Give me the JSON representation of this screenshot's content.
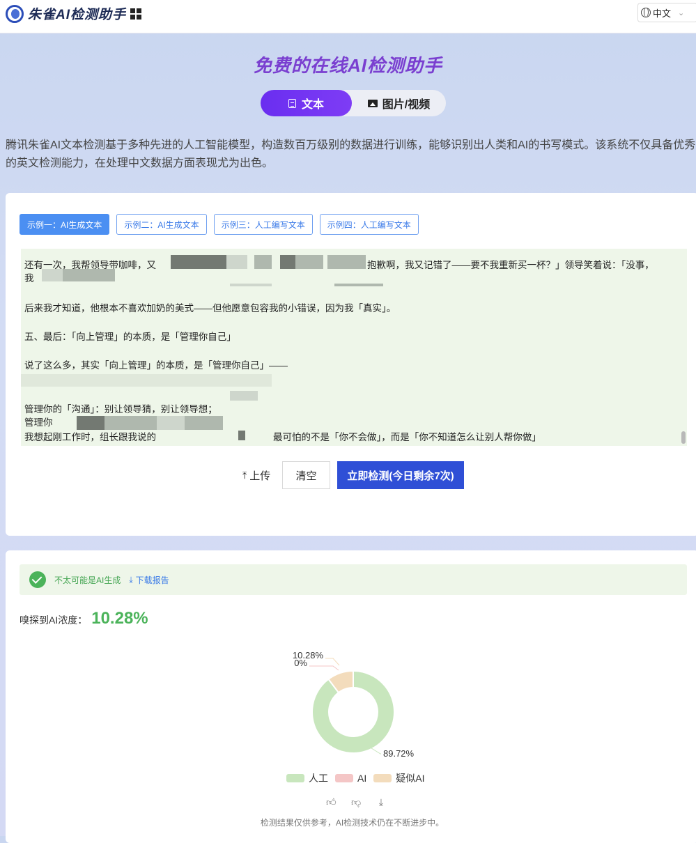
{
  "header": {
    "brand": "朱雀AI检测助手",
    "language": "中文"
  },
  "hero": {
    "title": "免费的在线AI检测助手",
    "tabs": [
      {
        "label": "文本",
        "active": true
      },
      {
        "label": "图片/视频",
        "active": false
      }
    ],
    "intro": "腾讯朱雀AI文本检测基于多种先进的人工智能模型，构造数百万级别的数据进行训练，能够识别出人类和AI的书写模式。该系统不仅具备优秀的英文检测能力，在处理中文数据方面表现尤为出色。"
  },
  "input": {
    "examples": [
      {
        "label": "示例一：AI生成文本",
        "active": true
      },
      {
        "label": "示例二：AI生成文本",
        "active": false
      },
      {
        "label": "示例三：人工编写文本",
        "active": false
      },
      {
        "label": "示例四：人工编写文本",
        "active": false
      }
    ],
    "text_lines": [
      "还有一次，我帮领导带咖啡，又",
      "抱歉啊，我又记错了——要不我重新买一杯？」领导笑着说：「没事，",
      "我",
      "后来我才知道，他根本不喜欢加奶的美式——但他愿意包容我的小错误，因为我「真实」。",
      "五、最后：「向上管理」的本质，是「管理你自己」",
      "说了这么多，其实「向上管理」的本质，是「管理你自己」——",
      "管理你的「沟通」：别让领导猜，别让领导想；",
      "管理你",
      "我想起刚工作时，组长跟我说的",
      "最可怕的不是「你不会做」，而是「你不知道怎么让别人帮你做」"
    ],
    "upload_label": "上传",
    "clear_label": "清空",
    "detect_label": "立即检测(今日剩余7次)"
  },
  "result": {
    "verdict": "不太可能是AI生成",
    "download_label": "下载报告",
    "ai_level_label": "嗅探到AI浓度：",
    "ai_level_value": "10.28%",
    "disclaimer": "检测结果仅供参考，AI检测技术仍在不断进步中。"
  },
  "chart_data": {
    "type": "pie",
    "donut": true,
    "categories": [
      "人工",
      "AI",
      "疑似AI"
    ],
    "values": [
      89.72,
      0,
      10.28
    ],
    "data_labels": [
      "89.72%",
      "0%",
      "10.28%"
    ],
    "colors": [
      "#c8e6bd",
      "#f4c6c6",
      "#f3dcbc"
    ],
    "legend_position": "bottom"
  },
  "colors": {
    "accent": "#7a3fd0",
    "primary_button": "#2f4fd6",
    "success": "#4bb35a",
    "link": "#3a7ae8"
  }
}
